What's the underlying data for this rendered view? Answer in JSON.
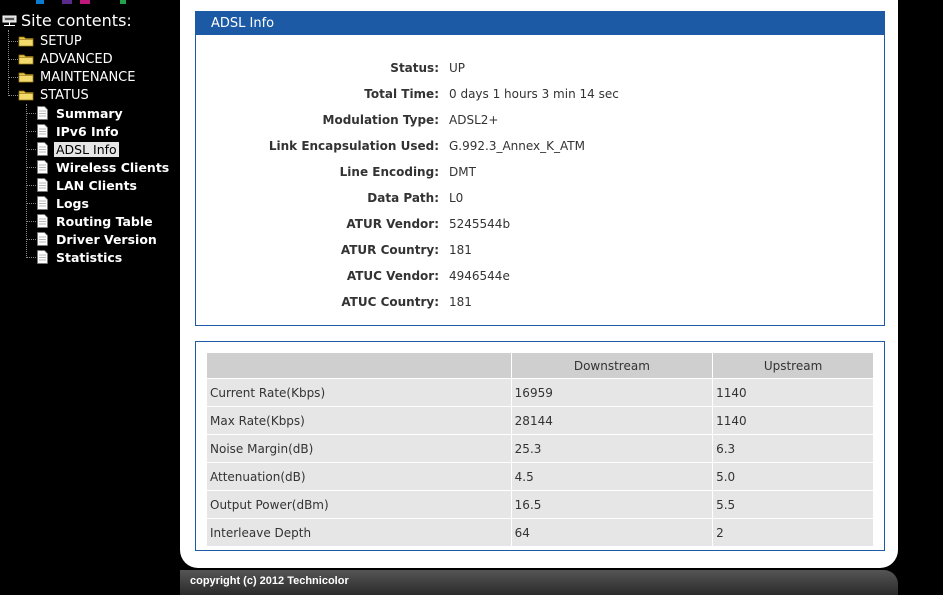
{
  "sidebar": {
    "root_label": "Site contents:",
    "sections": [
      {
        "label": "SETUP"
      },
      {
        "label": "ADVANCED"
      },
      {
        "label": "MAINTENANCE"
      },
      {
        "label": "STATUS"
      }
    ],
    "status_items": [
      {
        "label": "Summary"
      },
      {
        "label": "IPv6 Info"
      },
      {
        "label": "ADSL Info",
        "selected": true
      },
      {
        "label": "Wireless Clients"
      },
      {
        "label": "LAN Clients"
      },
      {
        "label": "Logs"
      },
      {
        "label": "Routing Table"
      },
      {
        "label": "Driver Version"
      },
      {
        "label": "Statistics"
      }
    ]
  },
  "info": {
    "title": "ADSL Info",
    "rows": [
      {
        "key": "Status:",
        "value": "UP"
      },
      {
        "key": "Total Time:",
        "value": "0 days 1 hours 3 min 14 sec"
      },
      {
        "key": "Modulation Type:",
        "value": "ADSL2+"
      },
      {
        "key": "Link Encapsulation Used:",
        "value": "G.992.3_Annex_K_ATM"
      },
      {
        "key": "Line Encoding:",
        "value": "DMT"
      },
      {
        "key": "Data Path:",
        "value": "L0"
      },
      {
        "key": "ATUR Vendor:",
        "value": "5245544b"
      },
      {
        "key": "ATUR Country:",
        "value": "181"
      },
      {
        "key": "ATUC Vendor:",
        "value": "4946544e"
      },
      {
        "key": "ATUC Country:",
        "value": "181"
      }
    ]
  },
  "rates": {
    "columns": [
      "",
      "Downstream",
      "Upstream"
    ],
    "rows": [
      [
        "Current Rate(Kbps)",
        "16959",
        "1140"
      ],
      [
        "Max Rate(Kbps)",
        "28144",
        "1140"
      ],
      [
        "Noise Margin(dB)",
        "25.3",
        "6.3"
      ],
      [
        "Attenuation(dB)",
        "4.5",
        "5.0"
      ],
      [
        "Output Power(dBm)",
        "16.5",
        "5.5"
      ],
      [
        "Interleave Depth",
        "64",
        "2"
      ]
    ]
  },
  "footer": {
    "copyright": "copyright (c) 2012 Technicolor"
  },
  "colors": {
    "accent": "#1c5aa6",
    "folder": "#e8c84a",
    "header_cell": "#cfcfcf",
    "body_cell": "#e6e6e6"
  },
  "icons": {
    "root": "computer-network-icon",
    "section": "folder-icon",
    "item": "document-icon"
  }
}
